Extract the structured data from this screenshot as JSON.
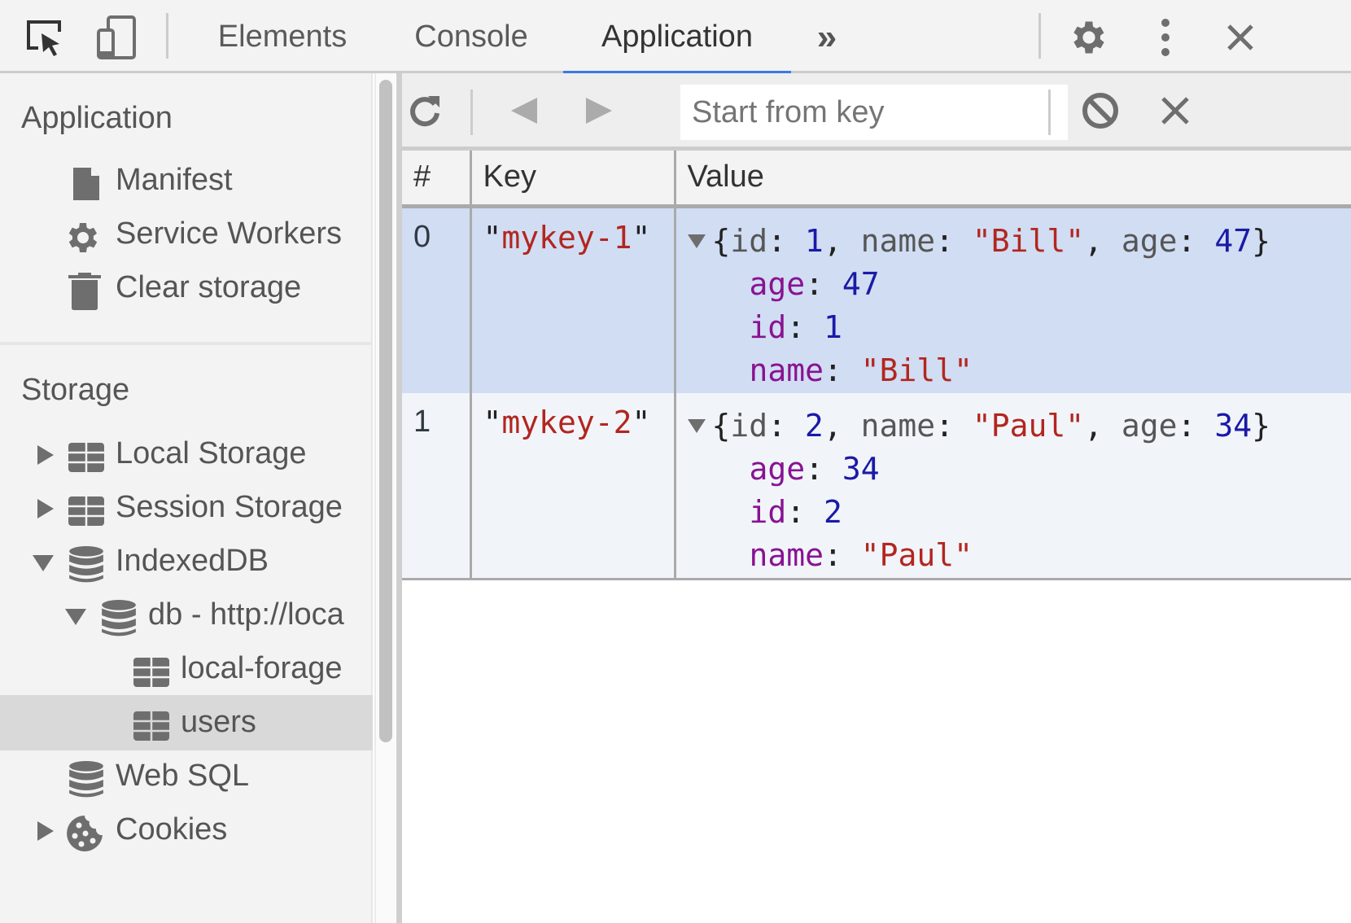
{
  "topbar": {
    "tabs": [
      {
        "label": "Elements",
        "active": false
      },
      {
        "label": "Console",
        "active": false
      },
      {
        "label": "Application",
        "active": true
      }
    ],
    "icons": {
      "inspect": "inspect-element-icon",
      "device": "device-toolbar-icon",
      "more_tabs": "»",
      "settings": "gear-icon",
      "menu": "kebab-menu-icon",
      "close": "close-icon"
    },
    "accent_color": "#3b78e7"
  },
  "sidebar": {
    "application_title": "Application",
    "application_items": [
      {
        "label": "Manifest",
        "icon": "document-icon"
      },
      {
        "label": "Service Workers",
        "icon": "gear-icon"
      },
      {
        "label": "Clear storage",
        "icon": "trash-icon"
      }
    ],
    "storage_title": "Storage",
    "storage_items": [
      {
        "label": "Local Storage",
        "icon": "table-icon",
        "expander": "collapsed"
      },
      {
        "label": "Session Storage",
        "icon": "table-icon",
        "expander": "collapsed"
      },
      {
        "label": "IndexedDB",
        "icon": "database-icon",
        "expander": "expanded"
      },
      {
        "label": "db - http://loca",
        "icon": "database-icon",
        "expander": "expanded"
      },
      {
        "label": "local-forage",
        "icon": "table-icon",
        "expander": "none"
      },
      {
        "label": "users",
        "icon": "table-icon",
        "expander": "none",
        "selected": true
      },
      {
        "label": "Web SQL",
        "icon": "database-icon",
        "expander": "none"
      },
      {
        "label": "Cookies",
        "icon": "cookie-icon",
        "expander": "collapsed"
      }
    ]
  },
  "toolbar": {
    "refresh": "refresh-icon",
    "prev": "previous-page-icon",
    "next": "next-page-icon",
    "key_input_placeholder": "Start from key",
    "key_input_value": "",
    "clear_store": "clear-icon",
    "delete_selected": "delete-icon"
  },
  "table": {
    "columns": [
      "#",
      "Key",
      "Value"
    ],
    "rows": [
      {
        "index": "0",
        "key": "mykey-1",
        "summary": {
          "id": "1",
          "name": "\"Bill\"",
          "age": "47"
        },
        "fields": [
          {
            "name": "age",
            "value": "47",
            "type": "number"
          },
          {
            "name": "id",
            "value": "1",
            "type": "number"
          },
          {
            "name": "name",
            "value": "\"Bill\"",
            "type": "string"
          }
        ],
        "selected": true
      },
      {
        "index": "1",
        "key": "mykey-2",
        "summary": {
          "id": "2",
          "name": "\"Paul\"",
          "age": "34"
        },
        "fields": [
          {
            "name": "age",
            "value": "34",
            "type": "number"
          },
          {
            "name": "id",
            "value": "2",
            "type": "number"
          },
          {
            "name": "name",
            "value": "\"Paul\"",
            "type": "string"
          }
        ],
        "selected": false
      }
    ]
  }
}
